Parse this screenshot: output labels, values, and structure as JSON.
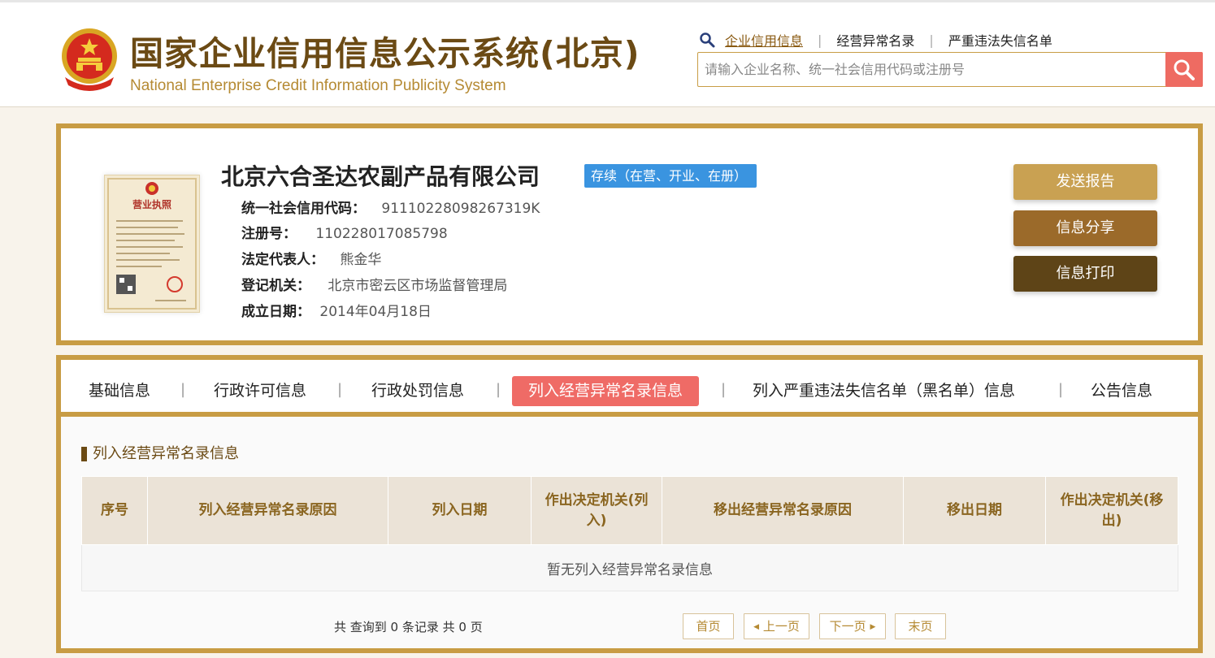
{
  "header": {
    "title_cn": "国家企业信用信息公示系统(北京)",
    "title_en": "National Enterprise Credit Information Publicity System",
    "links": [
      {
        "label": "企业信用信息",
        "active": true
      },
      {
        "label": "经营异常名录",
        "active": false
      },
      {
        "label": "严重违法失信名单",
        "active": false
      }
    ],
    "search": {
      "placeholder": "请输入企业名称、统一社会信用代码或注册号",
      "value": ""
    }
  },
  "company": {
    "name": "北京六合圣达农副产品有限公司",
    "status": "存续（在营、开业、在册）",
    "license_text": "营业执照",
    "fields": [
      {
        "label": "统一社会信用代码：",
        "value": "91110228098267319K"
      },
      {
        "label": "注册号：",
        "value": "110228017085798"
      },
      {
        "label": "法定代表人：",
        "value": "熊金华"
      },
      {
        "label": "登记机关：",
        "value": "北京市密云区市场监督管理局"
      },
      {
        "label": "成立日期：",
        "value": "2014年04月18日"
      }
    ],
    "actions": [
      {
        "label": "发送报告",
        "color": "#c9a152"
      },
      {
        "label": "信息分享",
        "color": "#9b6a2a"
      },
      {
        "label": "信息打印",
        "color": "#5e4417"
      }
    ]
  },
  "tabs": [
    {
      "label": "基础信息",
      "active": false
    },
    {
      "label": "行政许可信息",
      "active": false
    },
    {
      "label": "行政处罚信息",
      "active": false
    },
    {
      "label": "列入经营异常名录信息",
      "active": true
    },
    {
      "label": "列入严重违法失信名单（黑名单）信息",
      "active": false
    },
    {
      "label": "公告信息",
      "active": false
    }
  ],
  "section": {
    "title": "列入经营异常名录信息",
    "columns": [
      "序号",
      "列入经营异常名录原因",
      "列入日期",
      "作出决定机关(列入)",
      "移出经营异常名录原因",
      "移出日期",
      "作出决定机关(移出)"
    ],
    "empty_text": "暂无列入经营异常名录信息"
  },
  "pager": {
    "summary": "共 查询到 0 条记录 共 0 页",
    "first": "首页",
    "prev": "上一页",
    "next": "下一页",
    "last": "末页"
  },
  "colors": {
    "gold_border": "#c89c44",
    "brand_brown": "#6b4a14",
    "status_blue": "#3a94e0",
    "active_tab": "#ef6b66",
    "search_button": "#ee6b62"
  }
}
